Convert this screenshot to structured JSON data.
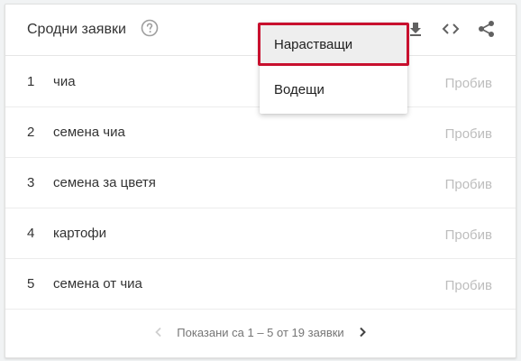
{
  "widget": {
    "title": "Сродни заявки",
    "help_icon": "help-circle-icon",
    "download_icon": "download-icon",
    "embed_icon": "code-icon",
    "share_icon": "share-icon"
  },
  "rows": [
    {
      "rank": "1",
      "term": "чиа",
      "value": "Пробив"
    },
    {
      "rank": "2",
      "term": "семена чиа",
      "value": "Пробив"
    },
    {
      "rank": "3",
      "term": "семена за цветя",
      "value": "Пробив"
    },
    {
      "rank": "4",
      "term": "картофи",
      "value": "Пробив"
    },
    {
      "rank": "5",
      "term": "семена от чиа",
      "value": "Пробив"
    }
  ],
  "pagination": {
    "label": "Показани са 1 – 5 от 19 заявки",
    "prev_enabled": false,
    "next_enabled": true
  },
  "sort_menu": {
    "options": [
      "Нарастващи",
      "Водещи"
    ],
    "selected": "Нарастващи",
    "highlight_color": "#c8102e"
  },
  "colors": {
    "text": "#333333",
    "value_muted": "#bdbdbd",
    "icon": "#616161",
    "icon_muted": "#bdbdbd"
  }
}
